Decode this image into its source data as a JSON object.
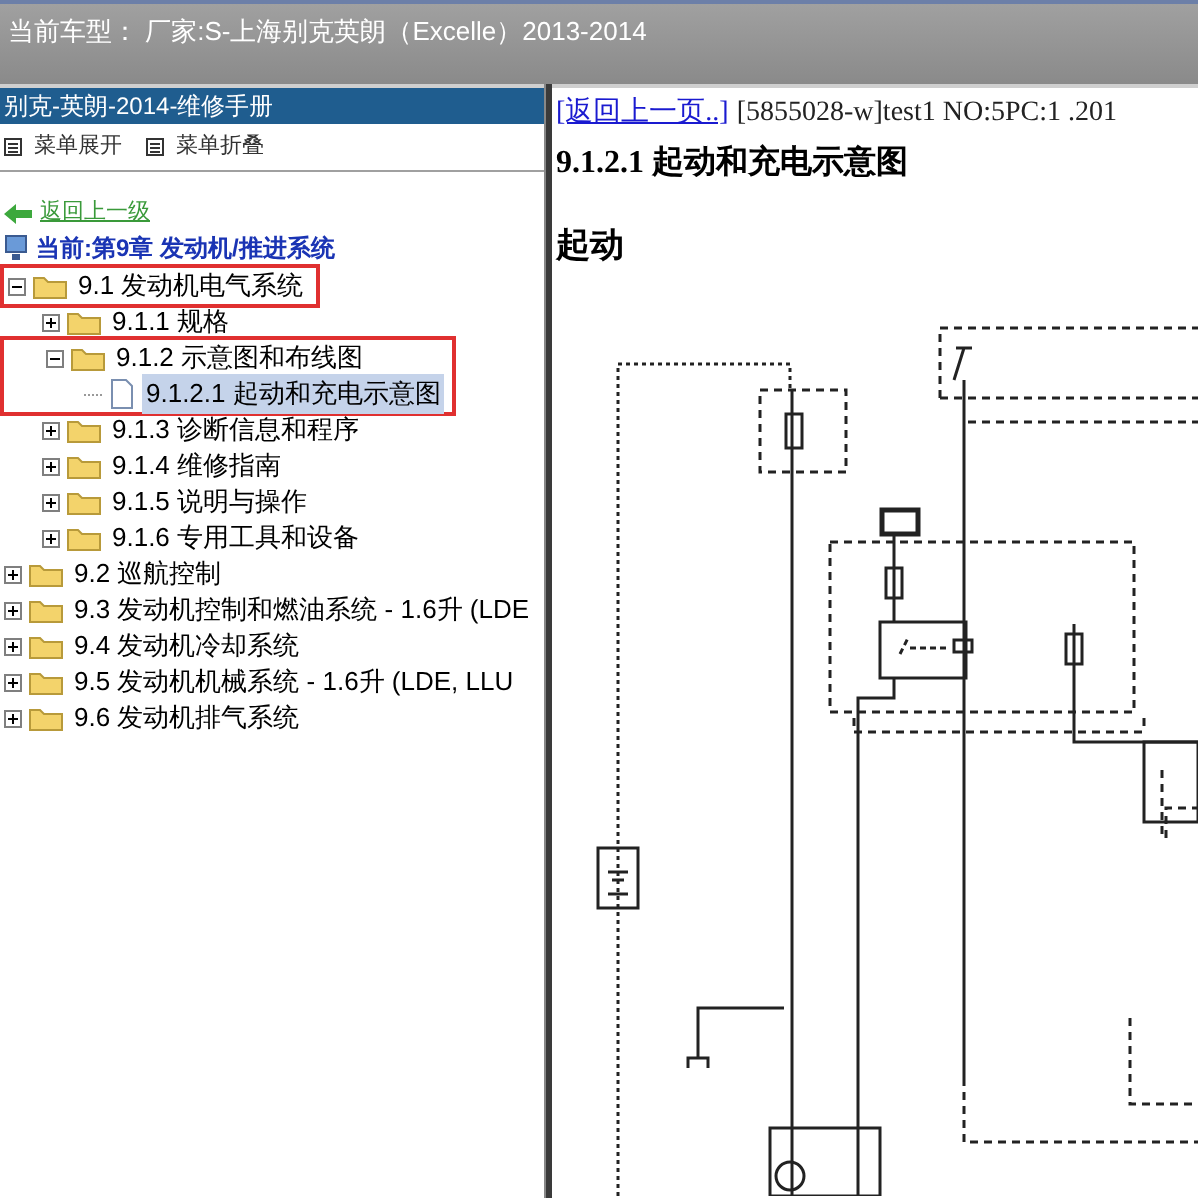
{
  "window": {
    "title": "当前车型： 厂家:S-上海别克英朗（Excelle）2013-2014"
  },
  "sidebar": {
    "title": "别克-英朗-2014-维修手册",
    "toolbar": [
      {
        "label": "菜单展开"
      },
      {
        "label": "菜单折叠"
      }
    ],
    "back_link": "返回上一级",
    "current": "当前:第9章 发动机/推进系统",
    "tree": [
      {
        "label": "9.1 发动机电气系统",
        "kind": "folder",
        "expanded": true,
        "selected": false,
        "row_highlighted": true,
        "children": [
          {
            "label": "9.1.1 规格",
            "kind": "folder",
            "expanded": false,
            "selected": false
          },
          {
            "label": "9.1.2 示意图和布线图",
            "kind": "folder",
            "expanded": true,
            "selected": false,
            "branch_highlighted": true,
            "children": [
              {
                "label": "9.1.2.1 起动和充电示意图",
                "kind": "page",
                "selected": true
              }
            ]
          },
          {
            "label": "9.1.3 诊断信息和程序",
            "kind": "folder",
            "expanded": false,
            "selected": false
          },
          {
            "label": "9.1.4 维修指南",
            "kind": "folder",
            "expanded": false,
            "selected": false
          },
          {
            "label": "9.1.5 说明与操作",
            "kind": "folder",
            "expanded": false,
            "selected": false
          },
          {
            "label": "9.1.6 专用工具和设备",
            "kind": "folder",
            "expanded": false,
            "selected": false
          }
        ]
      },
      {
        "label": "9.2 巡航控制",
        "kind": "folder",
        "expanded": false,
        "selected": false
      },
      {
        "label": "9.3 发动机控制和燃油系统 - 1.6升 (LDE",
        "kind": "folder",
        "expanded": false,
        "selected": false
      },
      {
        "label": "9.4 发动机冷却系统",
        "kind": "folder",
        "expanded": false,
        "selected": false
      },
      {
        "label": "9.5 发动机机械系统 - 1.6升 (LDE, LLU",
        "kind": "folder",
        "expanded": false,
        "selected": false
      },
      {
        "label": "9.6 发动机排气系统",
        "kind": "folder",
        "expanded": false,
        "selected": false
      }
    ]
  },
  "document": {
    "back_link": "[返回上一页..]",
    "doc_info": "[5855028-w]test1 NO:5PC:1 .201",
    "title": "9.1.2.1 起动和充电示意图",
    "section": "起动"
  }
}
